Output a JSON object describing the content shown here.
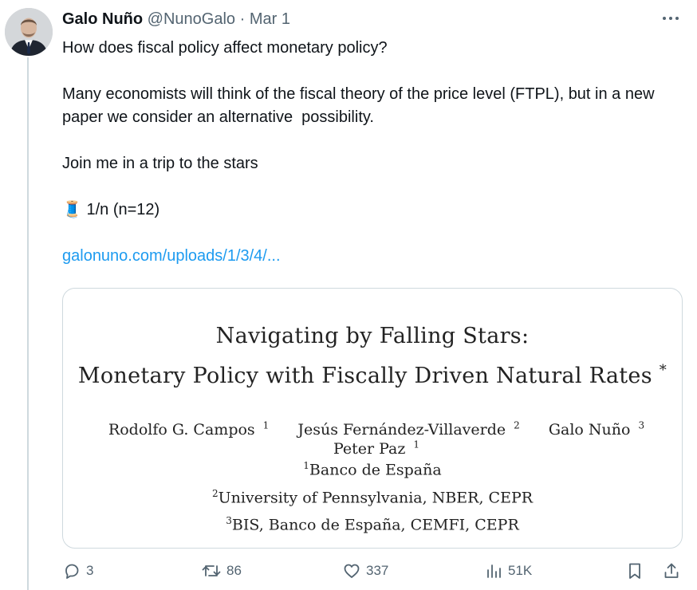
{
  "tweet": {
    "author_name": "Galo Nuño",
    "handle": "@NunoGalo",
    "separator": "·",
    "date": "Mar 1",
    "body": {
      "line1": "How does fiscal policy affect monetary policy?",
      "line2": "Many economists will think of the fiscal theory of the price level (FTPL), but in a new paper we consider an alternative  possibility.",
      "line3": "Join me in a trip to the stars",
      "emoji": "🧵",
      "line4": "1/n (n=12)",
      "link": "galonuno.com/uploads/1/3/4/..."
    }
  },
  "card": {
    "title_line1": "Navigating by Falling Stars:",
    "title_line2": "Monetary Policy with Fiscally Driven Natural Rates",
    "title_star": "*",
    "authors": [
      {
        "name": "Rodolfo G. Campos",
        "sup": "1"
      },
      {
        "name": "Jesús Fernández-Villaverde",
        "sup": "2"
      },
      {
        "name": "Galo Nuño",
        "sup": "3"
      },
      {
        "name": "Peter Paz",
        "sup": "1"
      }
    ],
    "affiliations": [
      {
        "sup": "1",
        "text": "Banco de España"
      },
      {
        "sup": "2",
        "text": "University of Pennsylvania, NBER, CEPR"
      },
      {
        "sup": "3",
        "text": "BIS, Banco de España, CEMFI, CEPR"
      }
    ]
  },
  "actions": {
    "replies": "3",
    "retweets": "86",
    "likes": "337",
    "views": "51K"
  },
  "colors": {
    "accent": "#1d9bf0",
    "muted": "#536471",
    "border": "#cfd9de"
  },
  "icons": [
    "more-icon",
    "reply-icon",
    "retweet-icon",
    "like-icon",
    "views-icon",
    "bookmark-icon",
    "share-icon"
  ]
}
